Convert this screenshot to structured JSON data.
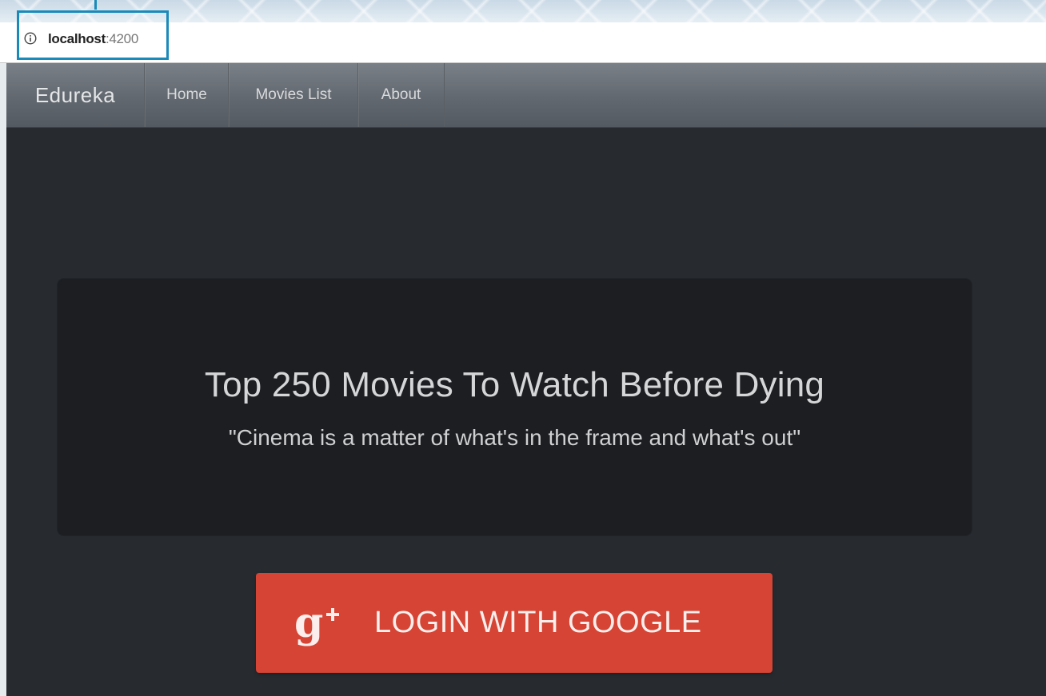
{
  "browser": {
    "url_host": "localhost",
    "url_port": ":4200"
  },
  "navbar": {
    "brand": "Edureka",
    "items": [
      {
        "label": "Home"
      },
      {
        "label": "Movies List"
      },
      {
        "label": "About"
      }
    ]
  },
  "hero": {
    "title": "Top 250 Movies To Watch Before Dying",
    "quote": "\"Cinema is a matter of what's in the frame and what's out\""
  },
  "login": {
    "label": "LOGIN WITH GOOGLE",
    "icon": "google-plus-icon",
    "color": "#d54434"
  },
  "colors": {
    "page_background": "#272b30",
    "jumbotron_background": "#1c1e22",
    "url_highlight": "#1a8ab9"
  }
}
